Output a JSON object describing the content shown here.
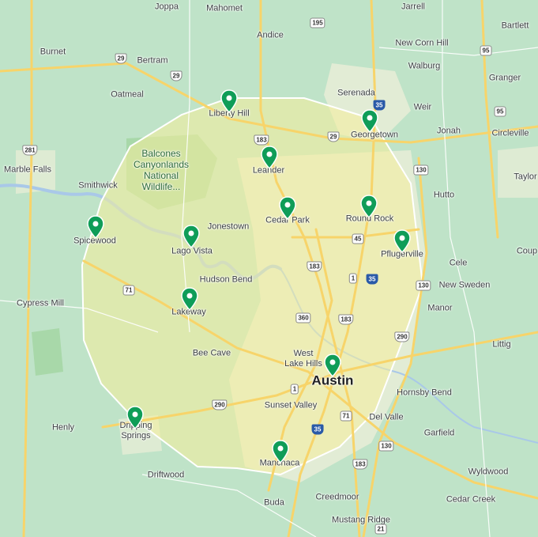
{
  "colors": {
    "land": "#bfe3c8",
    "urban": "#e6ecd6",
    "park": "#a8d8a9",
    "water": "#a9c8e8",
    "radius_fill": "#f6ee9a",
    "radius_stroke": "#ffffff",
    "road": "#f7d46a",
    "pin": "#0f9d58"
  },
  "places": [
    {
      "key": "joppa",
      "label": "Joppa"
    },
    {
      "key": "mahomet",
      "label": "Mahomet"
    },
    {
      "key": "jarrell",
      "label": "Jarrell"
    },
    {
      "key": "bartlett",
      "label": "Bartlett"
    },
    {
      "key": "andice",
      "label": "Andice"
    },
    {
      "key": "new_corn_hill",
      "label": "New Corn Hill"
    },
    {
      "key": "burnet",
      "label": "Burnet"
    },
    {
      "key": "bertram",
      "label": "Bertram"
    },
    {
      "key": "walburg",
      "label": "Walburg"
    },
    {
      "key": "granger",
      "label": "Granger"
    },
    {
      "key": "oatmeal",
      "label": "Oatmeal"
    },
    {
      "key": "serenada",
      "label": "Serenada"
    },
    {
      "key": "weir",
      "label": "Weir"
    },
    {
      "key": "liberty_hill",
      "label": "Liberty Hill"
    },
    {
      "key": "georgetown",
      "label": "Georgetown"
    },
    {
      "key": "jonah",
      "label": "Jonah"
    },
    {
      "key": "circleville",
      "label": "Circleville"
    },
    {
      "key": "marble_falls",
      "label": "Marble Falls"
    },
    {
      "key": "leander",
      "label": "Leander"
    },
    {
      "key": "taylor",
      "label": "Taylor"
    },
    {
      "key": "smithwick",
      "label": "Smithwick"
    },
    {
      "key": "hutto",
      "label": "Hutto"
    },
    {
      "key": "cedar_park",
      "label": "Cedar Park"
    },
    {
      "key": "round_rock",
      "label": "Round Rock"
    },
    {
      "key": "jonestown",
      "label": "Jonestown"
    },
    {
      "key": "spicewood",
      "label": "Spicewood"
    },
    {
      "key": "lago_vista",
      "label": "Lago Vista"
    },
    {
      "key": "pflugerville",
      "label": "Pflugerville"
    },
    {
      "key": "coupland",
      "label": "Coup"
    },
    {
      "key": "cele",
      "label": "Cele"
    },
    {
      "key": "hudson_bend",
      "label": "Hudson Bend"
    },
    {
      "key": "new_sweden",
      "label": "New Sweden"
    },
    {
      "key": "cypress_mill",
      "label": "Cypress Mill"
    },
    {
      "key": "lakeway",
      "label": "Lakeway"
    },
    {
      "key": "manor",
      "label": "Manor"
    },
    {
      "key": "littig",
      "label": "Littig"
    },
    {
      "key": "bee_cave",
      "label": "Bee Cave"
    },
    {
      "key": "west_lake_hills",
      "label": "West\nLake Hills"
    },
    {
      "key": "austin",
      "label": "Austin"
    },
    {
      "key": "hornsby_bend",
      "label": "Hornsby Bend"
    },
    {
      "key": "sunset_valley",
      "label": "Sunset Valley"
    },
    {
      "key": "del_valle",
      "label": "Del Valle"
    },
    {
      "key": "henly",
      "label": "Henly"
    },
    {
      "key": "dripping_springs",
      "label": "Dripping\nSprings"
    },
    {
      "key": "garfield",
      "label": "Garfield"
    },
    {
      "key": "manchaca",
      "label": "Manchaca"
    },
    {
      "key": "wyldwood",
      "label": "Wyldwood"
    },
    {
      "key": "driftwood",
      "label": "Driftwood"
    },
    {
      "key": "creedmoor",
      "label": "Creedmoor"
    },
    {
      "key": "buda",
      "label": "Buda"
    },
    {
      "key": "cedar_creek",
      "label": "Cedar Creek"
    },
    {
      "key": "mustang_ridge",
      "label": "Mustang Ridge"
    }
  ],
  "park_label": "Balcones\nCanyonlands\nNational\nWildlife...",
  "route_shields": [
    {
      "num": "195",
      "type": "state"
    },
    {
      "num": "29",
      "type": "us"
    },
    {
      "num": "29",
      "type": "us"
    },
    {
      "num": "281",
      "type": "us"
    },
    {
      "num": "183",
      "type": "us"
    },
    {
      "num": "29",
      "type": "us"
    },
    {
      "num": "35",
      "type": "i"
    },
    {
      "num": "95",
      "type": "state"
    },
    {
      "num": "95",
      "type": "state"
    },
    {
      "num": "130",
      "type": "state"
    },
    {
      "num": "45",
      "type": "state"
    },
    {
      "num": "183",
      "type": "us"
    },
    {
      "num": "71",
      "type": "state"
    },
    {
      "num": "1",
      "type": "state"
    },
    {
      "num": "35",
      "type": "i"
    },
    {
      "num": "360",
      "type": "state"
    },
    {
      "num": "183",
      "type": "us"
    },
    {
      "num": "130",
      "type": "state"
    },
    {
      "num": "290",
      "type": "us"
    },
    {
      "num": "1",
      "type": "state"
    },
    {
      "num": "290",
      "type": "us"
    },
    {
      "num": "71",
      "type": "state"
    },
    {
      "num": "35",
      "type": "i"
    },
    {
      "num": "130",
      "type": "state"
    },
    {
      "num": "183",
      "type": "us"
    },
    {
      "num": "21",
      "type": "state"
    }
  ],
  "markers": [
    {
      "key": "liberty-hill"
    },
    {
      "key": "georgetown"
    },
    {
      "key": "leander"
    },
    {
      "key": "cedar-park"
    },
    {
      "key": "round-rock"
    },
    {
      "key": "spicewood"
    },
    {
      "key": "lago-vista"
    },
    {
      "key": "pflugerville"
    },
    {
      "key": "lakeway"
    },
    {
      "key": "austin"
    },
    {
      "key": "dripping-springs"
    },
    {
      "key": "manchaca"
    }
  ]
}
